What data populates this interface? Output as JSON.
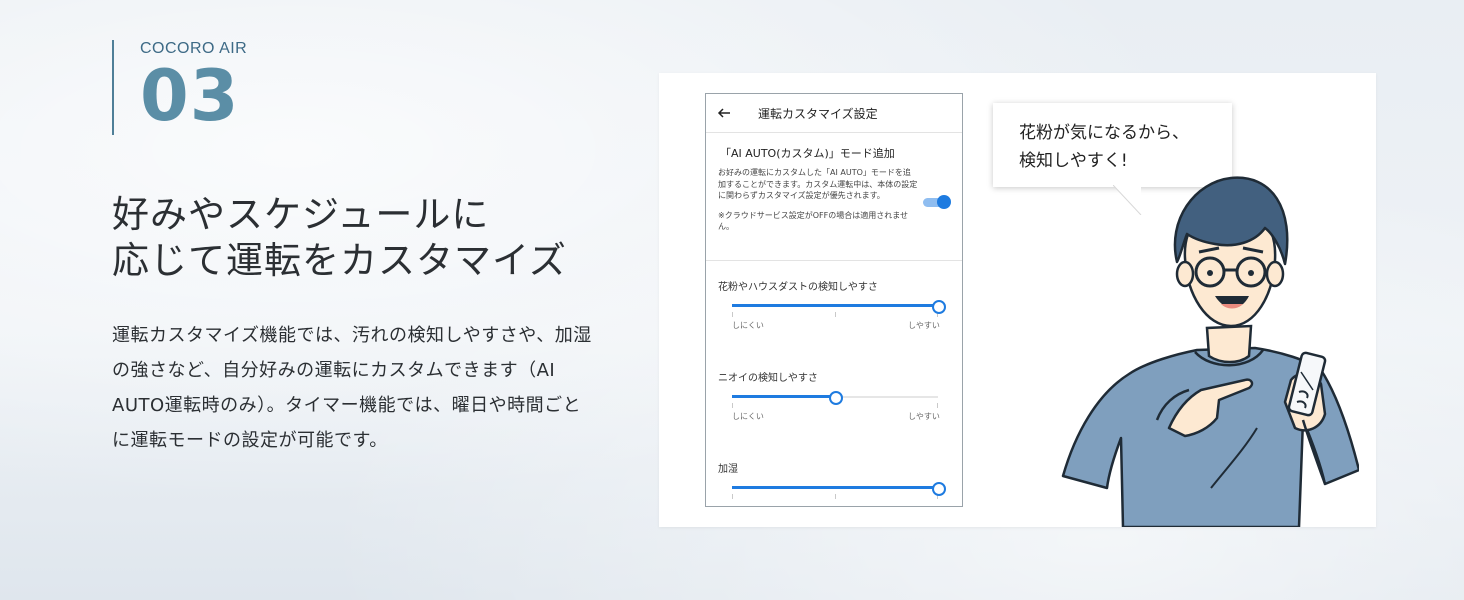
{
  "brand": "COCORO AIR",
  "feature_number": "03",
  "headline": {
    "line1": "好みやスケジュールに",
    "line2": "応じて運転をカスタマイズ"
  },
  "body": "運転カスタマイズ機能では、汚れの検知しやすさや、加湿の強さなど、自分好みの運転にカスタムできます（AI AUTO運転時のみ）。タイマー機能では、曜日や時間ごとに運転モードの設定が可能です。",
  "app": {
    "header_title": "運転カスタマイズ設定",
    "section_title": "「AI AUTO(カスタム)」モード追加",
    "description": "お好みの運転にカスタムした「AI AUTO」モードを追加することができます。カスタム運転中は、本体の設定に関わらずカスタマイズ設定が優先されます。",
    "note": "※クラウドサービス設定がOFFの場合は適用されません。",
    "toggle_on": true,
    "sliders": [
      {
        "label": "花粉やハウスダストの検知しやすさ",
        "min_label": "しにくい",
        "max_label": "しやすい",
        "value": 1.0
      },
      {
        "label": "ニオイの検知しやすさ",
        "min_label": "しにくい",
        "max_label": "しやすい",
        "value": 0.5
      },
      {
        "label": "加湿",
        "min_label": "",
        "max_label": "",
        "value": 1.0
      }
    ]
  },
  "speech_bubble": {
    "line1": "花粉が気になるから、",
    "line2": "検知しやすく!"
  },
  "colors": {
    "accent_blue": "#1e7be0",
    "number_teal": "#5b8ea6",
    "shirt_blue": "#7f9fbe"
  }
}
